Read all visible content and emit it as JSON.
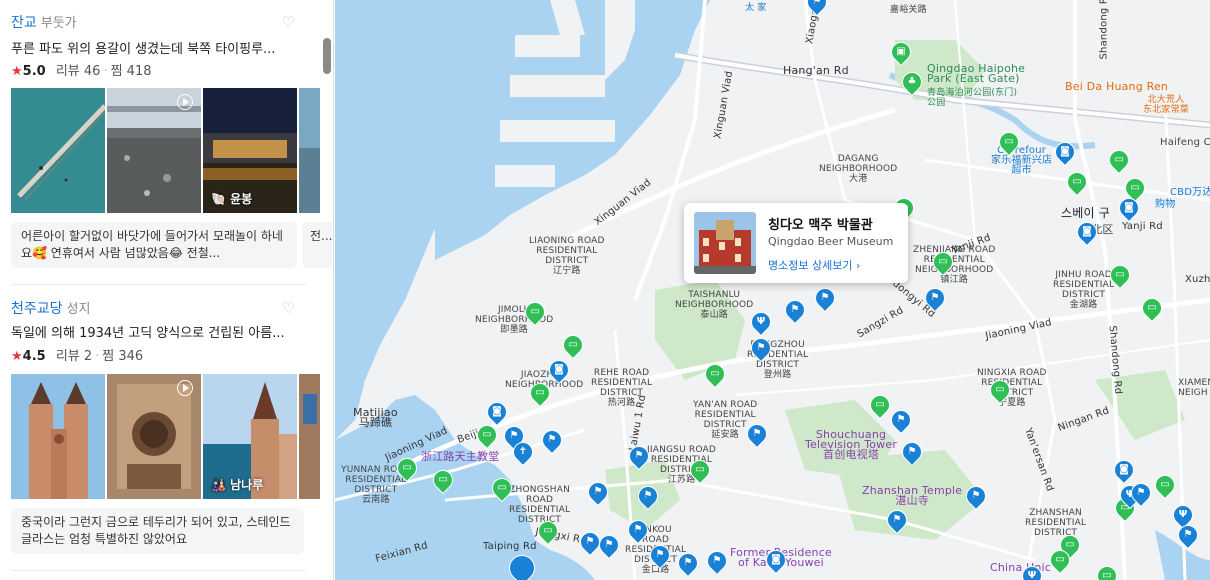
{
  "list": {
    "places": [
      {
        "name": "잔교",
        "category": "부둣가",
        "description": "푸른 파도 위의 용갈이 생겼는데 북쪽 타이핑루...",
        "rating": "5.0",
        "reviews_label": "리뷰 46",
        "saves_label": "찜 418",
        "photo_label": "윤봉",
        "review_text": "어른아이 할거없이 바닷가에 들어가서 모래놀이 하네요🥰 연휴여서 사람 넘많았음😂 전철...",
        "review_peek": "전..."
      },
      {
        "name": "천주교당",
        "category": "성지",
        "description": "독일에 의해 1934년 고딕 양식으로 건립된 아름...",
        "rating": "4.5",
        "reviews_label": "리뷰 2",
        "saves_label": "찜 346",
        "photo_label": "남나루",
        "review_text": "중국이라 그런지 금으로 테두리가 되어 있고, 스테인드글라스는 엄청 특별하진 않았어요"
      }
    ]
  },
  "popup": {
    "title_ko": "칭다오 맥주 박물관",
    "title_en": "Qingdao Beer Museum",
    "link": "명소정보 상세보기 ›"
  },
  "map_labels": {
    "hangan_rd": "Hang'an Rd",
    "park_en": "Qingdao Haipohe\nPark (East Gate)",
    "park_zh": "青岛海泊河公园(东门)\n公园",
    "bei_da_huang": "Bei Da Huang Ren",
    "bei_da_huang_zh": "北大荒人\n东北家常菜",
    "carrefour": "Carrefour\n家乐福新兴店\n超市",
    "haifeng": "Haifeng C",
    "dagang": "DAGANG\nNEIGHBORHOOD\n大港",
    "xinguan_viad": "Xinguan Viad",
    "xinguan_viad2": "Xinguan Viad",
    "liaoning": "LIAONING ROAD\nRESIDENTIAL\nDISTRICT\n辽宁路",
    "taishanlu": "TAISHANLU\nNEIGHBORHOOD\n泰山路",
    "jimolu": "JIMOLU\nNEIGHBORHOOD\n即墨路",
    "jiaozhou": "JIAOZHOU\nNEIGHBORHOOD",
    "rehe": "REHE ROAD\nRESIDENTIAL\nDISTRICT\n热河路",
    "yanan": "YAN'AN ROAD\nRESIDENTIAL\nDISTRICT\n延安路",
    "dengzhou": "DENGZHOU\nRESIDENTIAL\nDISTRICT\n登州路",
    "jiangsu": "JIANGSU ROAD\nRESIDENTIAL\nDISTRICT\n江苏路",
    "zhongshan": "ZHONGSHAN\nROAD\nRESIDENTIAL\nDISTRICT",
    "yunnan": "YUNNAN ROAD\nRESIDENTIAL\nDISTRICT\n云南路",
    "jinkou": "JINKOU\nROAD\nRESIDENTIAL\nDISTRICT\n金口路",
    "zhenjiang": "ZHENJIANG ROAD\nRESIDENTIAL\nNEIGHBORHOOD\n镇江路",
    "jinhu": "JINHU ROAD\nRESIDENTIAL\nDISTRICT\n金湖路",
    "ningxia": "NINGXIA ROAD\nRESIDENTIAL\nDISTRICT\n宁夏路",
    "xiamen": "XIAMEN\nNEIGH",
    "zhanshan_res": "ZHANSHAN\nRESIDENTIAL\nDISTRICT",
    "matijiao": "Matijiao\n马蹄礁",
    "shouchuang": "Shouchuang\nTelevision Tower\n首创电视塔",
    "zhanshan_temple": "Zhanshan Temple\n湛山寺",
    "former_res": "Former Residence\nof Kang Youwei",
    "church_zh": "浙江路天主教堂",
    "sbeige_ko": "스베이 구",
    "sbeige_zh": "市北区",
    "cbd": "CBD万达",
    "shopping": "购物",
    "jiaoning_viad": "Jiaoning Viad",
    "yanji_rd": "Yanji Rd",
    "yanji_rd2": "Yanji Rd",
    "taidongyi": "Taidongyi Rd",
    "sangzi": "Sangzi Rd",
    "xuzhou": "Xuzhou Rd",
    "shandong": "Shandong Rd",
    "shandong2": "Shandong Rd",
    "jiangxi": "Jiangxi Rd",
    "laiwu": "Laiwu 1 Rd",
    "taiping": "Taiping Rd",
    "feixian": "Feixian Rd",
    "jiaoning_viad2": "Jiaoning Viad",
    "yanersan": "Yan'ersan Rd",
    "xinjiang": "Xinjiang Rd",
    "jinan": "Jinan Rd",
    "beijing": "Beijing",
    "jiangxi_rd": "Jiangxi Rd",
    "zhangzhou": "Zhangzhou R",
    "tonganrd": "Tong'an Rd",
    "xiaogang": "Xiaogang",
    "gaoqing": "Gaoqing Rd",
    "tai_jia": "太 家",
    "jiayunan": "嘉峪关路",
    "cs": "China Unic",
    "ycrd": "Yichuan Rd",
    "ningan": "Ningan Rd"
  },
  "colors": {
    "water": "#a9d3f1",
    "land": "#f1f2f4",
    "park": "#cfe8c9",
    "road_major": "#ffffff",
    "pin_green": "#2fbf56",
    "pin_blue": "#1a82d6",
    "accent": "#1a6fd4",
    "star": "#e8323c"
  }
}
